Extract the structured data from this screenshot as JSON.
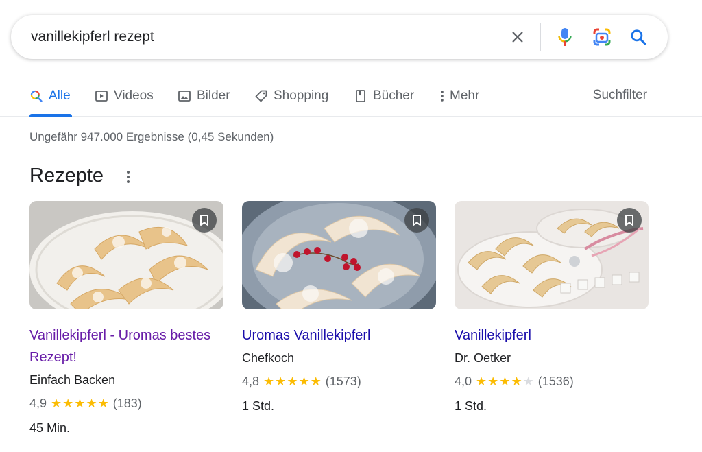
{
  "search": {
    "query": "vanillekipferl rezept"
  },
  "tabs": [
    {
      "label": "Alle",
      "icon": "search-multicolor-icon"
    },
    {
      "label": "Videos",
      "icon": "video-icon"
    },
    {
      "label": "Bilder",
      "icon": "image-icon"
    },
    {
      "label": "Shopping",
      "icon": "tag-icon"
    },
    {
      "label": "Bücher",
      "icon": "book-icon"
    },
    {
      "label": "Mehr",
      "icon": "more-vert-icon"
    }
  ],
  "filters_label": "Suchfilter",
  "result_stats": "Ungefähr 947.000 Ergebnisse (0,45 Sekunden)",
  "recipes_section": {
    "title": "Rezepte",
    "cards": [
      {
        "title": "Vanillekipferl - Uromas bestes Rezept!",
        "source": "Einfach Backen",
        "rating": "4,9",
        "stars": 5,
        "reviews": "(183)",
        "time": "45 Min."
      },
      {
        "title": "Uromas Vanillekipferl",
        "source": "Chefkoch",
        "rating": "4,8",
        "stars": 5,
        "reviews": "(1573)",
        "time": "1 Std."
      },
      {
        "title": "Vanillekipferl",
        "source": "Dr. Oetker",
        "rating": "4,0",
        "stars": 4,
        "reviews": "(1536)",
        "time": "1 Std."
      }
    ]
  },
  "colors": {
    "accent": "#1a73e8",
    "link": "#1a0dab",
    "visited": "#681da8",
    "star": "#fbbc04"
  }
}
